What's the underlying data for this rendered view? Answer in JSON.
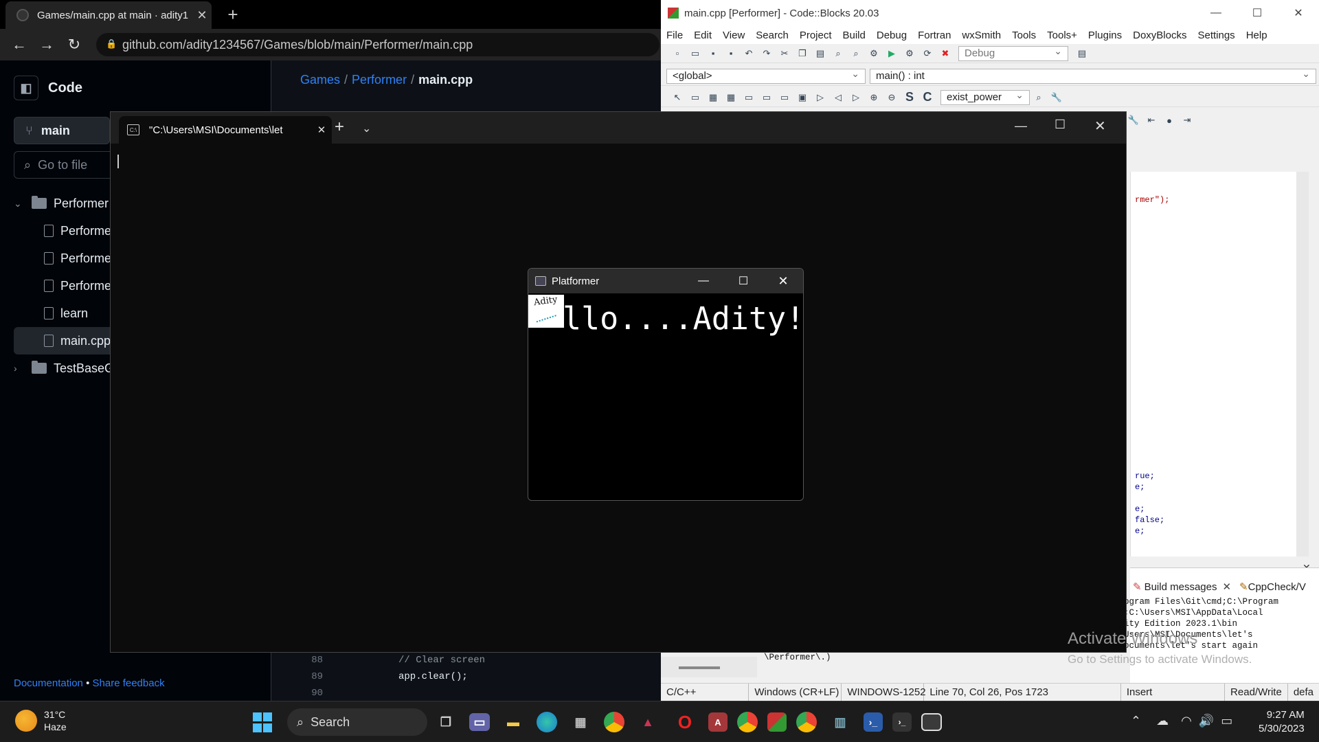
{
  "chrome": {
    "tab_title": "Games/main.cpp at main · adity1",
    "url": "github.com/adity1234567/Games/blob/main/Performer/main.cpp"
  },
  "github": {
    "code_label": "Code",
    "branch": "main",
    "goto_placeholder": "Go to file",
    "tree": [
      {
        "label": "Performer",
        "type": "folder",
        "expanded": true
      },
      {
        "label": "Performe",
        "type": "file"
      },
      {
        "label": "Performe",
        "type": "file"
      },
      {
        "label": "Performe",
        "type": "file"
      },
      {
        "label": "learn",
        "type": "file"
      },
      {
        "label": "main.cpp",
        "type": "file",
        "selected": true
      },
      {
        "label": "TestBaseGa",
        "type": "folder",
        "expanded": false
      }
    ],
    "breadcrumb": {
      "repo": "Games",
      "folder": "Performer",
      "file": "main.cpp"
    },
    "footer": {
      "doc": "Documentation",
      "sep": "•",
      "feedback": "Share feedback"
    },
    "code_lines": [
      {
        "num": "88",
        "text": "// Clear screen"
      },
      {
        "num": "89",
        "text": "app.clear();"
      },
      {
        "num": "90",
        "text": ""
      }
    ]
  },
  "codeblocks": {
    "title": "main.cpp [Performer] - Code::Blocks 20.03",
    "menu": [
      "File",
      "Edit",
      "View",
      "Search",
      "Project",
      "Build",
      "Debug",
      "Fortran",
      "wxSmith",
      "Tools",
      "Tools+",
      "Plugins",
      "DoxyBlocks",
      "Settings",
      "Help"
    ],
    "build_target": "Debug",
    "scope": "<global>",
    "function": "main() : int",
    "symbol": "exist_power",
    "editor_snippets": [
      "rmer\");",
      "rue;",
      "e;",
      "e;",
      "false;",
      "e;"
    ],
    "bottom_tabs": {
      "build_messages": "Build messages",
      "cppcheck": "CppCheck/V"
    },
    "log_lines": [
      "ogram Files\\Git\\cmd;C:\\Program",
      ";C:\\Users\\MSI\\AppData\\Local",
      "ity Edition 2023.1\\bin",
      "Users\\MSI\\Documents\\let's",
      "ocuments\\let's start again"
    ],
    "log_left": "\\Performer\\.)",
    "status": [
      "C/C++",
      "Windows (CR+LF)",
      "WINDOWS-1252",
      "Line 70, Col 26, Pos 1723",
      "Insert",
      "Read/Write",
      "defa"
    ]
  },
  "terminal": {
    "tab_title": "\"C:\\Users\\MSI\\Documents\\let"
  },
  "platformer": {
    "title": "Platformer",
    "text": "llo....Adity!",
    "sprite_text": "Adity"
  },
  "watermark": {
    "line1": "Activate Windows",
    "line2": "Go to Settings to activate Windows."
  },
  "taskbar": {
    "weather_temp": "31°C",
    "weather_desc": "Haze",
    "search": "Search",
    "time": "9:27 AM",
    "date": "5/30/2023"
  }
}
